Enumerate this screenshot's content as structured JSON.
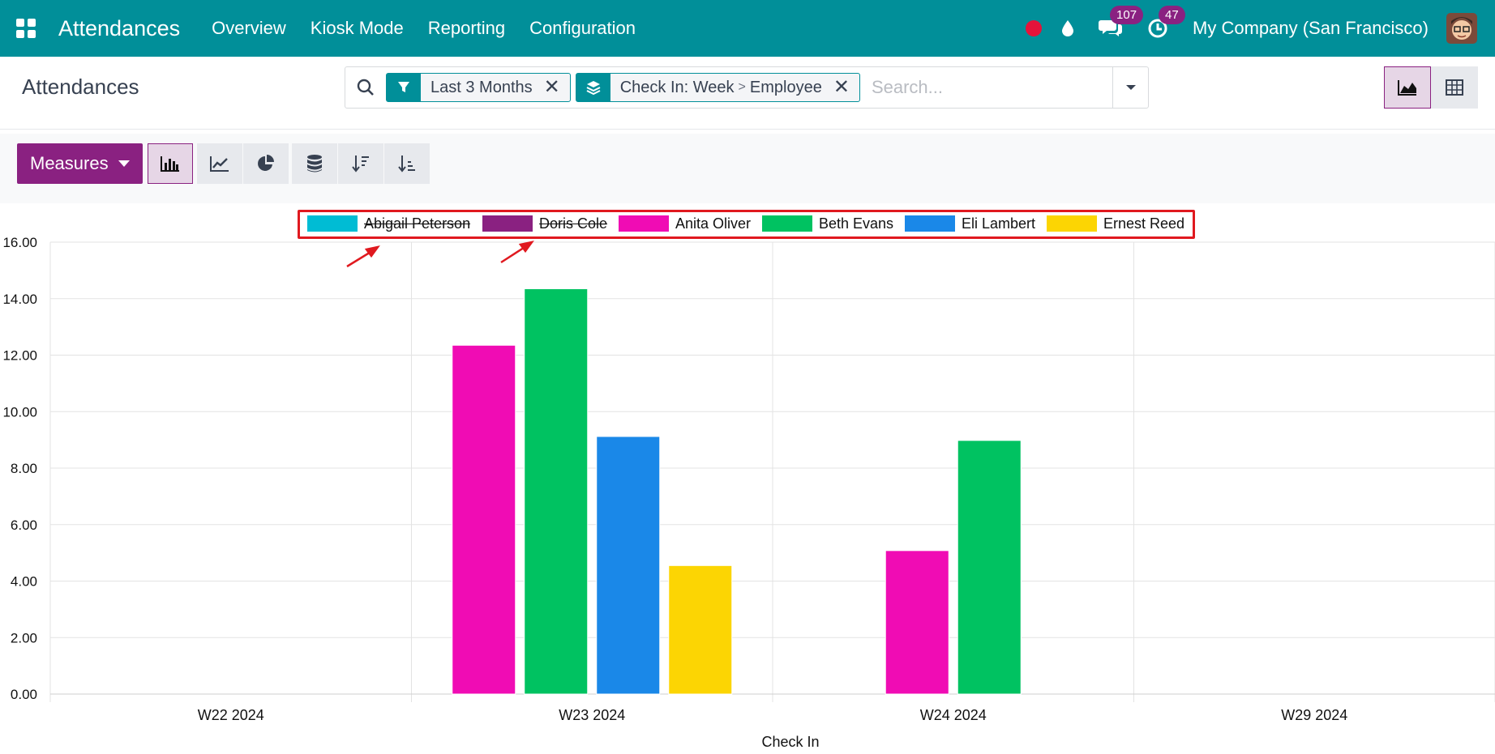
{
  "navbar": {
    "app_title": "Attendances",
    "menu": [
      "Overview",
      "Kiosk Mode",
      "Reporting",
      "Configuration"
    ],
    "messages_count": "107",
    "activities_count": "47",
    "company": "My Company (San Francisco)"
  },
  "control_panel": {
    "title": "Attendances",
    "facets": {
      "filter": "Last 3 Months",
      "groupby_first": "Check In: Week",
      "groupby_sep": ">",
      "groupby_second": "Employee"
    },
    "search_placeholder": "Search..."
  },
  "toolbar": {
    "measures_label": "Measures"
  },
  "colors": {
    "navbar": "#018f99",
    "primary": "#8a2181",
    "highlight": "#e0191f"
  },
  "chart_data": {
    "type": "bar",
    "categories": [
      "W22 2024",
      "W23 2024",
      "W24 2024",
      "W29 2024"
    ],
    "xlabel": "Check In",
    "ylabel": "",
    "ylim": [
      0,
      16
    ],
    "yticks": [
      "0.00",
      "2.00",
      "4.00",
      "6.00",
      "8.00",
      "10.00",
      "12.00",
      "14.00",
      "16.00"
    ],
    "grid": true,
    "legend_position": "top-center",
    "series": [
      {
        "name": "Abigail Peterson",
        "color": "#00bcd4",
        "hidden": true,
        "values": [
          null,
          null,
          null,
          null
        ]
      },
      {
        "name": "Doris Cole",
        "color": "#8a2181",
        "hidden": true,
        "values": [
          null,
          null,
          null,
          null
        ]
      },
      {
        "name": "Anita Oliver",
        "color": "#f00cb4",
        "hidden": false,
        "values": [
          null,
          12.35,
          5.08,
          null
        ]
      },
      {
        "name": "Beth Evans",
        "color": "#00c261",
        "hidden": false,
        "values": [
          null,
          14.35,
          8.98,
          null
        ]
      },
      {
        "name": "Eli Lambert",
        "color": "#1a88e8",
        "hidden": false,
        "values": [
          null,
          9.12,
          null,
          null
        ]
      },
      {
        "name": "Ernest Reed",
        "color": "#fcd503",
        "hidden": false,
        "values": [
          null,
          4.55,
          null,
          null
        ]
      }
    ]
  }
}
